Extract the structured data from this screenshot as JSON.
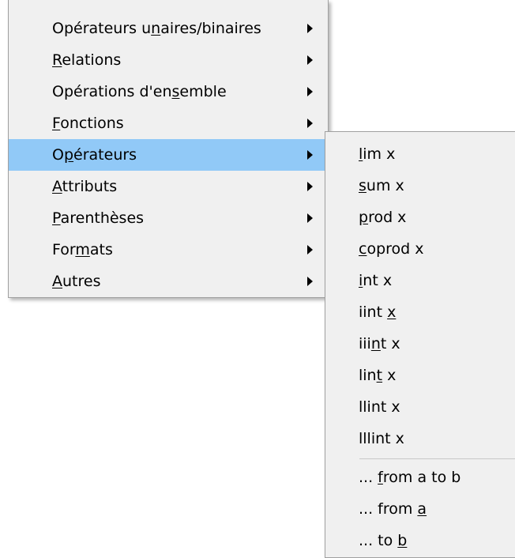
{
  "main_menu": {
    "items": [
      {
        "pre": "Opérateurs u",
        "accel": "n",
        "post": "aires/binaires"
      },
      {
        "pre": "",
        "accel": "R",
        "post": "elations"
      },
      {
        "pre": "Opérations d'en",
        "accel": "s",
        "post": "emble"
      },
      {
        "pre": "",
        "accel": "F",
        "post": "onctions"
      },
      {
        "pre": "O",
        "accel": "p",
        "post": "érateurs"
      },
      {
        "pre": "",
        "accel": "A",
        "post": "ttributs"
      },
      {
        "pre": "",
        "accel": "P",
        "post": "arenthèses"
      },
      {
        "pre": "For",
        "accel": "m",
        "post": "ats"
      },
      {
        "pre": "",
        "accel": "A",
        "post": "utres"
      }
    ],
    "highlighted_index": 4,
    "highlight_color": "#91c9f7"
  },
  "sub_menu": {
    "items": [
      {
        "pre": "",
        "accel": "l",
        "post": "im x"
      },
      {
        "pre": "",
        "accel": "s",
        "post": "um x"
      },
      {
        "pre": "",
        "accel": "p",
        "post": "rod x"
      },
      {
        "pre": "",
        "accel": "c",
        "post": "oprod x"
      },
      {
        "pre": "",
        "accel": "i",
        "post": "nt x"
      },
      {
        "pre": "iint ",
        "accel": "x",
        "post": ""
      },
      {
        "pre": "iii",
        "accel": "n",
        "post": "t x"
      },
      {
        "pre": "lin",
        "accel": "t",
        "post": " x"
      },
      {
        "pre": "llint x",
        "accel": "",
        "post": ""
      },
      {
        "pre": "lllint x",
        "accel": "",
        "post": ""
      }
    ],
    "limit_items": [
      {
        "pre": "... ",
        "accel": "f",
        "post": "rom a to b"
      },
      {
        "pre": "... from ",
        "accel": "a",
        "post": ""
      },
      {
        "pre": "... to ",
        "accel": "b",
        "post": ""
      }
    ]
  }
}
